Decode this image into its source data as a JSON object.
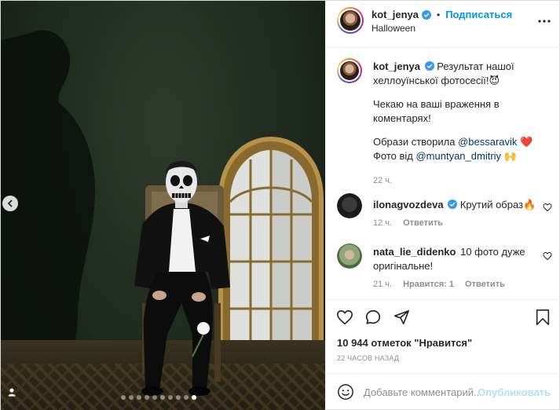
{
  "post": {
    "username": "kot_jenya",
    "separator": "•",
    "follow_label": "Подписаться",
    "location": "Halloween",
    "carousel": {
      "total_slides": 10,
      "active_slide": 10
    }
  },
  "caption": {
    "username": "kot_jenya",
    "line1": "Результат нашої хеллоуїнської фотосесії!",
    "emoji1": "😈",
    "line2": "Чекаю на ваші враження в коментарях!",
    "line3_prefix": "Образи створила",
    "mention1": "@bessaravik",
    "emoji2": "❤️",
    "line4_prefix": "Фото від",
    "mention2": "@muntyan_dmitriy",
    "emoji3": "🙌",
    "time": "22 ч."
  },
  "comments": [
    {
      "username": "ilonagvozdeva",
      "verified": true,
      "text": "Крутий образ",
      "emoji": "🔥",
      "time": "12 ч.",
      "reply_label": "Ответить"
    },
    {
      "username": "nata_lie_didenko",
      "verified": false,
      "text": "10 фото дуже оригінальне!",
      "time": "21 ч.",
      "likes_label": "Нравится: 1",
      "reply_label": "Ответить"
    }
  ],
  "likes": {
    "text": "10 944 отметок \"Нравится\""
  },
  "posted_ago": "22 ЧАСОВ НАЗАД",
  "comment_box": {
    "placeholder": "Добавьте комментарий...",
    "publish_label": "Опубликовать"
  },
  "colors": {
    "accent": "#0095f6",
    "publish_disabled": "#b2dffc",
    "muted": "#8e8e8e",
    "mention": "#00376b"
  },
  "icons": [
    "verified-badge-icon",
    "more-options-icon",
    "heart-icon",
    "comment-icon",
    "share-icon",
    "bookmark-icon",
    "emoji-icon",
    "chevron-left-icon",
    "user-tag-icon"
  ]
}
